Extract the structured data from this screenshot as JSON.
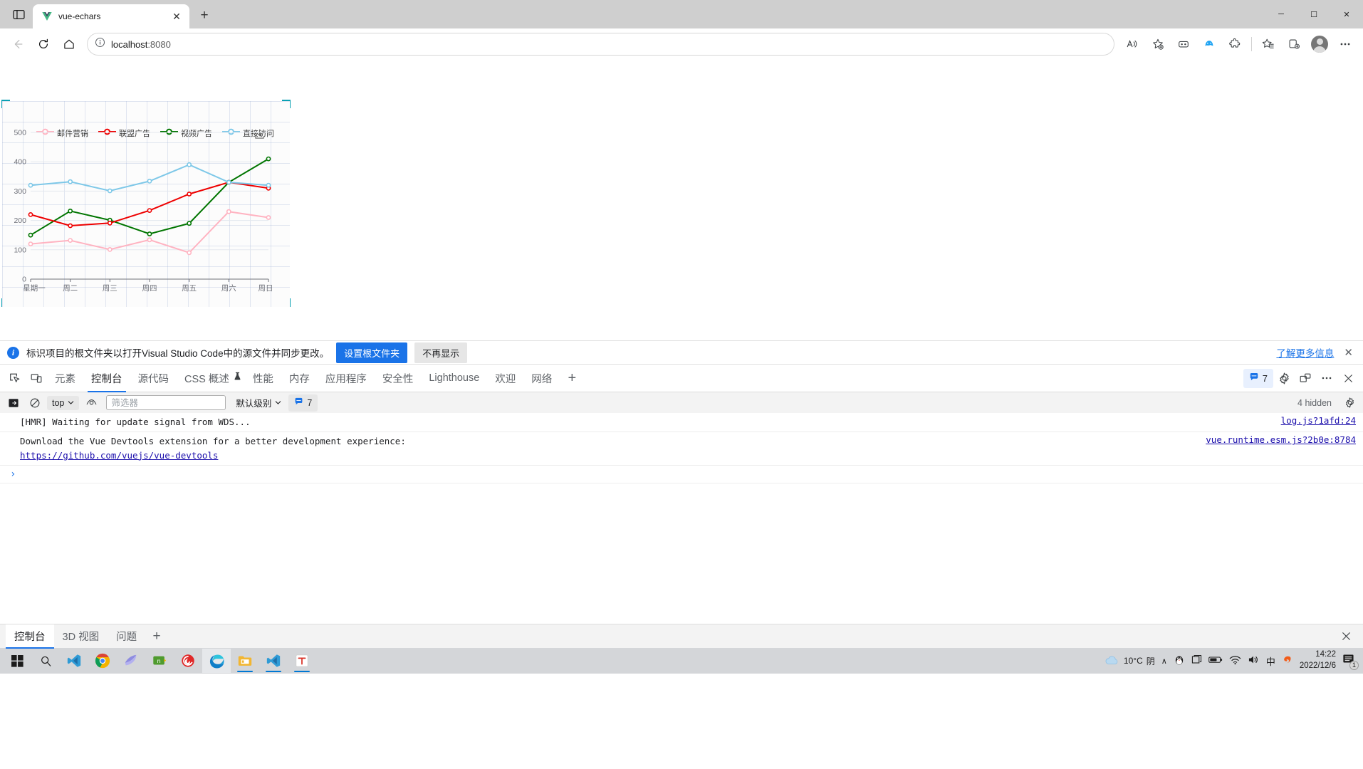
{
  "browser": {
    "tab": {
      "title": "vue-echars",
      "favicon": "vue-logo-icon",
      "close_label": "✕"
    },
    "new_tab_label": "+",
    "window_controls": {
      "minimize": "─",
      "maximize": "☐",
      "close": "✕"
    },
    "nav": {
      "back": "←",
      "reload": "⟳",
      "home": "⌂"
    },
    "omnibox": {
      "host": "localhost",
      "port": ":8080",
      "info_icon": "info-circle-icon"
    },
    "toolbar_icons": [
      "read-aloud-icon",
      "add-favorite-icon",
      "collections-icon",
      "browser-essentials-icon",
      "extensions-icon",
      "favorites-icon",
      "split-screen-icon",
      "profile-avatar",
      "settings-more-icon"
    ]
  },
  "chart_data": {
    "type": "line",
    "title": "",
    "xlabel": "",
    "ylabel": "",
    "categories": [
      "星期一",
      "周二",
      "周三",
      "周四",
      "周五",
      "周六",
      "周日"
    ],
    "ytick_labels": [
      "0",
      "100",
      "200",
      "300",
      "400",
      "500"
    ],
    "ylim": [
      0,
      500
    ],
    "grid": true,
    "legend_position": "top",
    "toolbox": [
      "save-as-image-icon"
    ],
    "series": [
      {
        "name": "邮件营销",
        "color": "#ffb3c1",
        "values": [
          120,
          132,
          101,
          134,
          90,
          230,
          210
        ]
      },
      {
        "name": "联盟广告",
        "color": "#ee0000",
        "values": [
          220,
          182,
          191,
          234,
          290,
          330,
          310
        ]
      },
      {
        "name": "视频广告",
        "color": "#007500",
        "values": [
          150,
          232,
          201,
          154,
          190,
          330,
          410
        ]
      },
      {
        "name": "直接访问",
        "color": "#7ec8e8",
        "values": [
          320,
          332,
          301,
          334,
          390,
          330,
          320
        ]
      }
    ]
  },
  "devtools": {
    "banner": {
      "icon": "info-icon",
      "text": "标识项目的根文件夹以打开Visual Studio Code中的源文件并同步更改。",
      "primary_button": "设置根文件夹",
      "secondary_button": "不再显示",
      "link": "了解更多信息",
      "close": "✕"
    },
    "tabs": [
      {
        "label": "元素",
        "active": false
      },
      {
        "label": "控制台",
        "active": true
      },
      {
        "label": "源代码",
        "active": false
      },
      {
        "label": "CSS 概述",
        "active": false,
        "suffix_icon": "flask-icon"
      },
      {
        "label": "性能",
        "active": false
      },
      {
        "label": "内存",
        "active": false
      },
      {
        "label": "应用程序",
        "active": false
      },
      {
        "label": "安全性",
        "active": false
      },
      {
        "label": "Lighthouse",
        "active": false
      },
      {
        "label": "欢迎",
        "active": false
      },
      {
        "label": "网络",
        "active": false
      }
    ],
    "tab_add_label": "+",
    "message_badge_count": "7",
    "right_icons": [
      "settings-gear-icon",
      "dock-side-icon",
      "more-options-icon",
      "close-devtools-icon"
    ],
    "console_toolbar": {
      "sidebar_toggle": "console-sidebar-icon",
      "clear_console": "clear-console-icon",
      "context_selector": "top",
      "live_expression": "eye-icon",
      "filter_placeholder": "筛选器",
      "filter_value": "",
      "level_selector": "默认级别",
      "issues_count": "7",
      "hidden_text": "4 hidden",
      "settings_icon": "settings-gear-icon"
    },
    "console_rows": [
      {
        "message": "[HMR] Waiting for update signal from WDS...",
        "link": "",
        "source": "log.js?1afd:24"
      },
      {
        "message": "Download the Vue Devtools extension for a better development experience:",
        "link": "https://github.com/vuejs/vue-devtools",
        "source": "vue.runtime.esm.js?2b0e:8784"
      }
    ],
    "prompt_caret": "›",
    "drawer_tabs": [
      {
        "label": "控制台",
        "active": true
      },
      {
        "label": "3D 视图",
        "active": false
      },
      {
        "label": "问题",
        "active": false
      }
    ],
    "drawer_add_label": "+",
    "drawer_close": "✕"
  },
  "taskbar": {
    "apps": [
      "windows-start-icon",
      "search-icon",
      "vscode-icon",
      "chrome-icon",
      "sql-server-icon",
      "navicat-icon",
      "snail-icon",
      "edge-icon",
      "file-explorer-icon",
      "vscode-icon-2",
      "typora-icon"
    ],
    "tray": {
      "weather_temp": "10°C",
      "weather_desc": "阴",
      "chevron": "∧",
      "icons": [
        "qq-penguin-icon",
        "window-icon",
        "battery-icon",
        "wifi-icon",
        "volume-icon",
        "ime-chinese-icon",
        "sogou-icon"
      ],
      "time": "14:22",
      "date": "2022/12/6",
      "notification_count": "1"
    }
  },
  "colors": {
    "accent_blue": "#1a73e8",
    "banner_primary": "#1a73e8",
    "taskbar_bg": "#d4d6d9",
    "inspect_outline": "#0aa1b3"
  }
}
